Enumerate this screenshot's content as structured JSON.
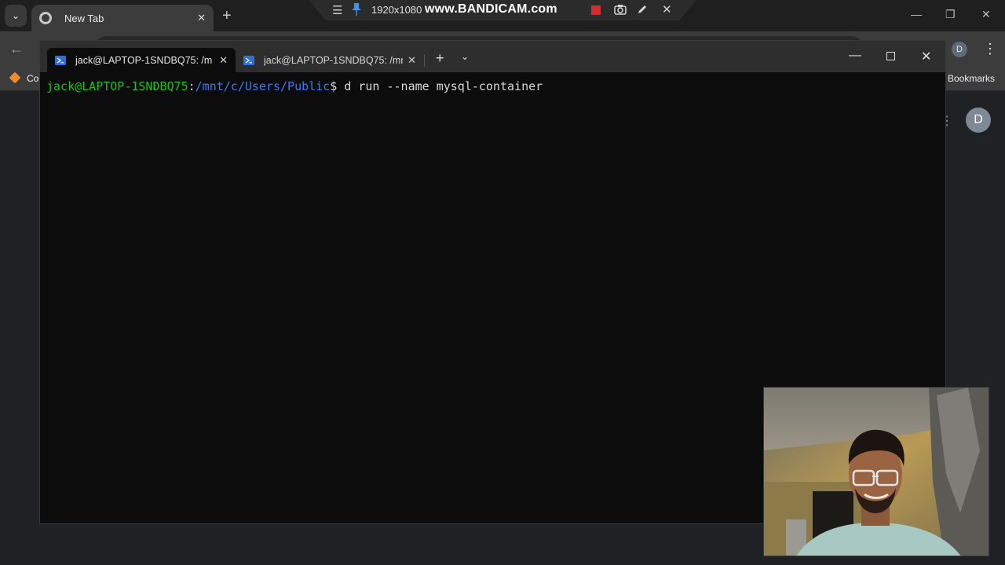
{
  "chrome": {
    "tab_title": "New Tab",
    "bookmark_partial": "Co",
    "bookmarks_label": "Bookmarks",
    "profile_initial": "D",
    "page_avatar_initial": "D"
  },
  "bandicam": {
    "resolution": "1920x1080",
    "brand": "www.BANDICAM.com"
  },
  "terminal": {
    "tabs": [
      {
        "title": "jack@LAPTOP-1SNDBQ75: /m"
      },
      {
        "title": "jack@LAPTOP-1SNDBQ75: /mr"
      }
    ],
    "prompt_user": "jack@LAPTOP-1SNDBQ75",
    "prompt_sep": ":",
    "prompt_path": "/mnt/c/Users/Public",
    "prompt_symbol": "$ ",
    "command": "d run --name mysql-container"
  },
  "colors": {
    "prompt_user": "#16c60c",
    "prompt_path": "#3b78ff",
    "terminal_bg": "#0c0c0c",
    "record": "#d32f2f"
  },
  "icons": [
    "chevron-down-icon",
    "chrome-icon",
    "close-icon",
    "plus-icon",
    "back-arrow-icon",
    "kebab-menu-icon",
    "bookmark-icon",
    "powershell-icon",
    "minimize-icon",
    "maximize-icon",
    "menu-icon",
    "pin-icon",
    "record-icon",
    "camera-icon",
    "pencil-icon"
  ]
}
